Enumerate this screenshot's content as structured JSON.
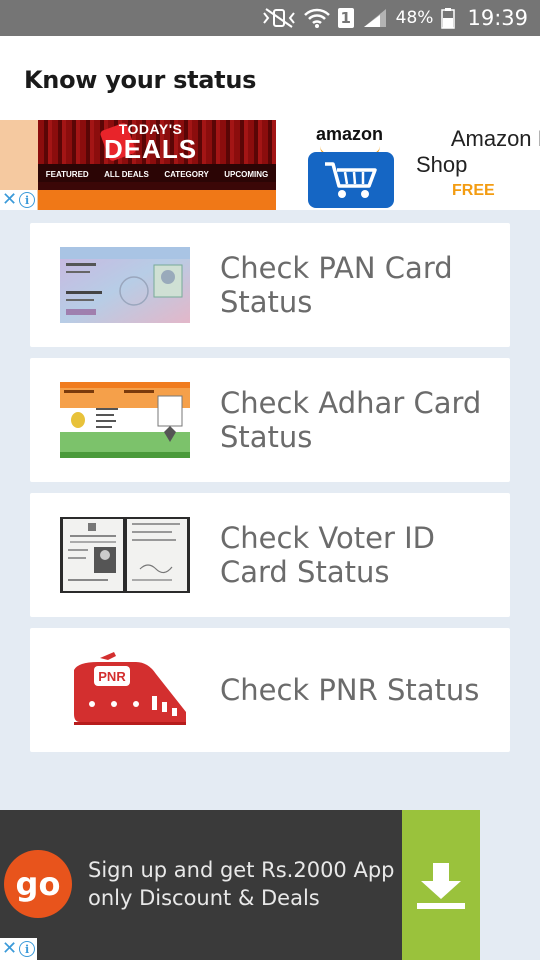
{
  "status_bar": {
    "sim_label": "1",
    "battery_percent": "48%",
    "time": "19:39"
  },
  "app_bar": {
    "title": "Know your status"
  },
  "top_ad": {
    "deals_logo_small": "TODAY'S",
    "deals_logo_big": "DEALS",
    "deals_nav": [
      "FEATURED",
      "ALL DEALS",
      "CATEGORY",
      "UPCOMING"
    ],
    "amazon_logo": "amazon",
    "amazon_title_line1": "Amazon In",
    "amazon_title_line2": "Shop",
    "amazon_price": "FREE"
  },
  "menu": {
    "items": [
      {
        "label": "Check PAN Card Status",
        "icon": "pan-card-icon"
      },
      {
        "label": "Check Adhar Card Status",
        "icon": "aadhaar-card-icon"
      },
      {
        "label": "Check Voter ID Card Status",
        "icon": "voter-id-card-icon"
      },
      {
        "label": "Check PNR Status",
        "icon": "train-pnr-icon"
      }
    ]
  },
  "bottom_ad": {
    "logo": "go",
    "text": "Sign up and get Rs.2000 App only Discount & Deals",
    "button_icon": "download-icon"
  },
  "colors": {
    "status_bar": "#757575",
    "background": "#e4ebf3",
    "card_text": "#6b6b6b",
    "train_red": "#d32f2f",
    "download_green": "#9ac23c",
    "go_orange": "#e8541c"
  }
}
